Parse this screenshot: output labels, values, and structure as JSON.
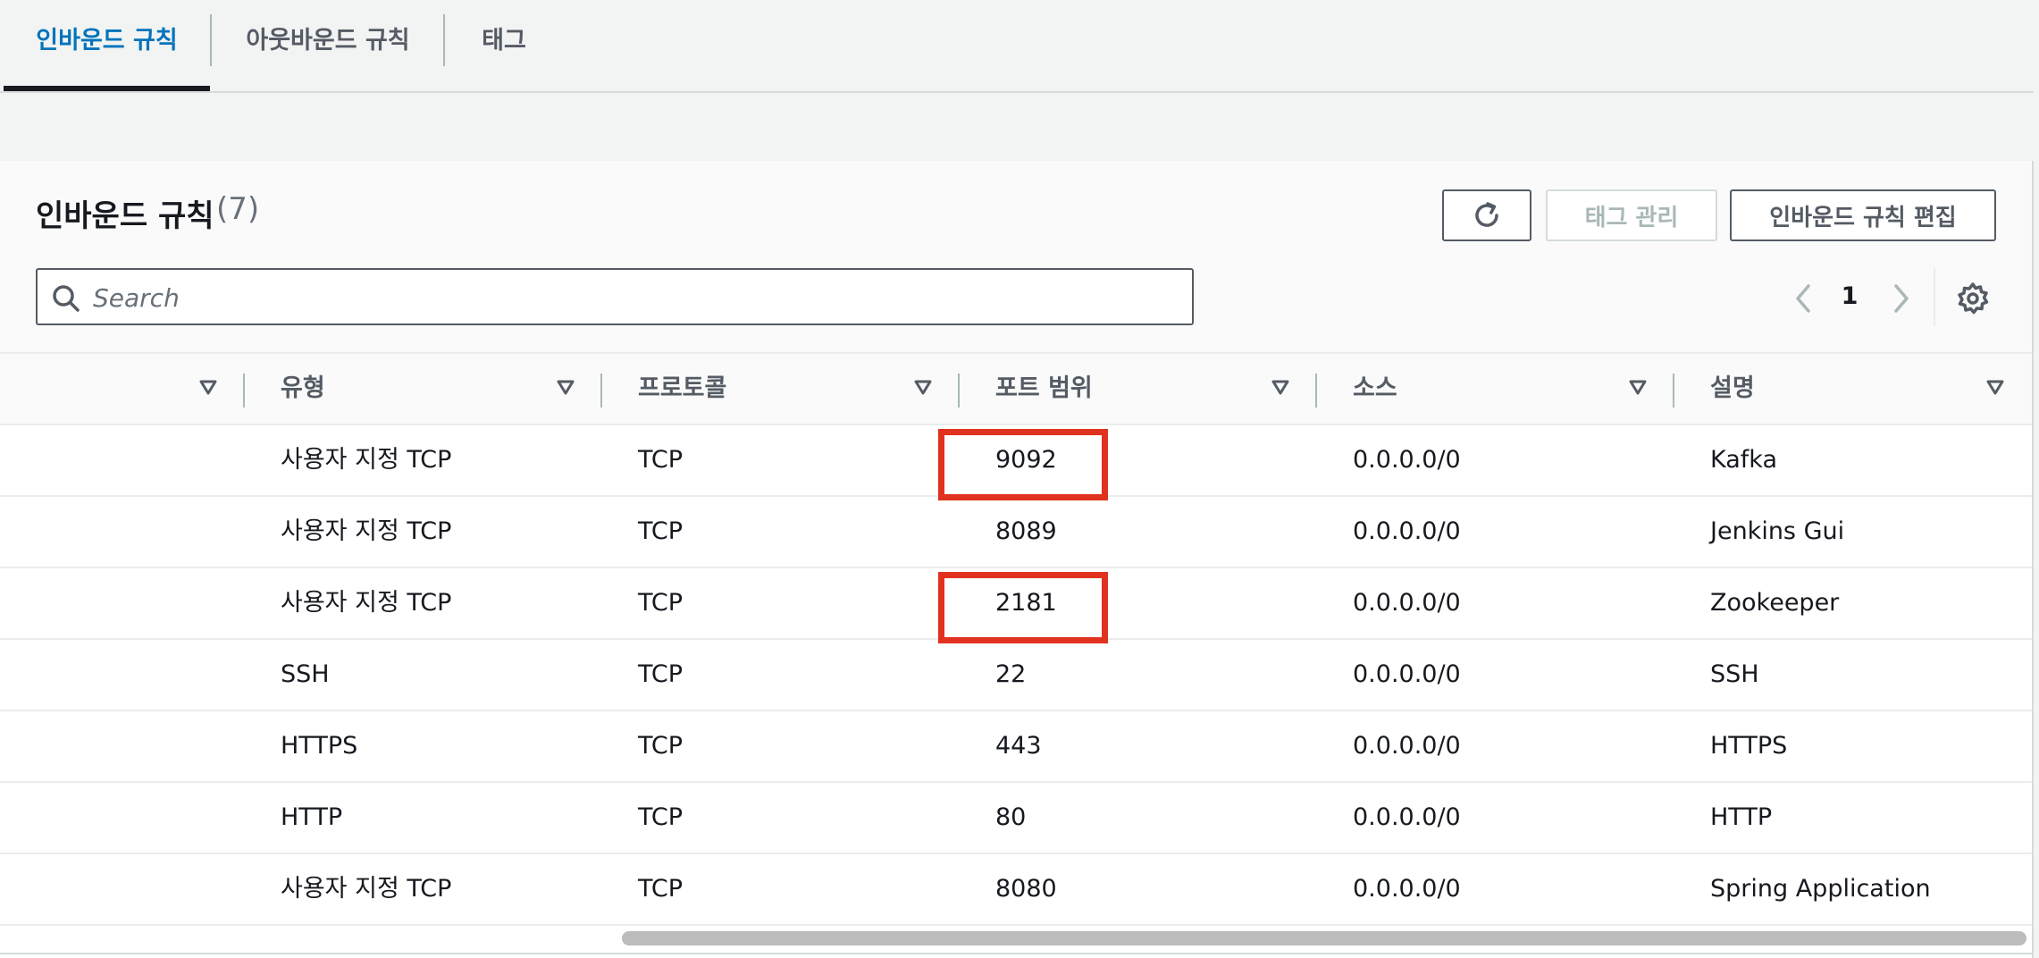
{
  "tabs": [
    {
      "label": "인바운드 규칙",
      "active": true
    },
    {
      "label": "아웃바운드 규칙",
      "active": false
    },
    {
      "label": "태그",
      "active": false
    }
  ],
  "panel": {
    "title": "인바운드 규칙",
    "count": "(7)",
    "buttons": {
      "manage_tags": "태그 관리",
      "edit_inbound": "인바운드 규칙 편집"
    },
    "search": {
      "placeholder": "Search",
      "value": ""
    },
    "pager": {
      "current_page": "1"
    }
  },
  "table": {
    "columns": [
      "유형",
      "프로토콜",
      "포트 범위",
      "소스",
      "설명"
    ],
    "rows": [
      {
        "type": "사용자 지정 TCP",
        "protocol": "TCP",
        "port": "9092",
        "source": "0.0.0.0/0",
        "description": "Kafka",
        "highlighted": true
      },
      {
        "type": "사용자 지정 TCP",
        "protocol": "TCP",
        "port": "8089",
        "source": "0.0.0.0/0",
        "description": "Jenkins Gui",
        "highlighted": false
      },
      {
        "type": "사용자 지정 TCP",
        "protocol": "TCP",
        "port": "2181",
        "source": "0.0.0.0/0",
        "description": "Zookeeper",
        "highlighted": true
      },
      {
        "type": "SSH",
        "protocol": "TCP",
        "port": "22",
        "source": "0.0.0.0/0",
        "description": "SSH",
        "highlighted": false
      },
      {
        "type": "HTTPS",
        "protocol": "TCP",
        "port": "443",
        "source": "0.0.0.0/0",
        "description": "HTTPS",
        "highlighted": false
      },
      {
        "type": "HTTP",
        "protocol": "TCP",
        "port": "80",
        "source": "0.0.0.0/0",
        "description": "HTTP",
        "highlighted": false
      },
      {
        "type": "사용자 지정 TCP",
        "protocol": "TCP",
        "port": "8080",
        "source": "0.0.0.0/0",
        "description": "Spring Application",
        "highlighted": false
      }
    ]
  },
  "icons": {
    "refresh": "refresh-icon",
    "search": "search-icon",
    "prev": "chevron-left-icon",
    "next": "chevron-right-icon",
    "settings": "gear-icon",
    "sort": "sort-down-icon"
  },
  "colors": {
    "accent": "#0073bb",
    "highlight_box": "#e0321f",
    "text": "#16191f",
    "muted": "#545b64"
  }
}
